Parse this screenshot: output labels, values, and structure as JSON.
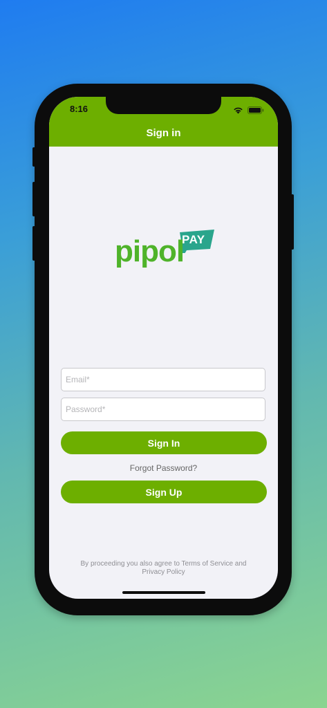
{
  "status_bar": {
    "time": "8:16",
    "wifi_icon": "wifi-icon",
    "battery_icon": "battery-icon"
  },
  "nav": {
    "title": "Sign in"
  },
  "logo": {
    "wordmark": "pipol",
    "badge": "PAY",
    "brand_green": "#4fb32a",
    "badge_color": "#2aa58c"
  },
  "form": {
    "email_placeholder": "Email*",
    "password_placeholder": "Password*",
    "email_value": "",
    "password_value": ""
  },
  "buttons": {
    "sign_in": "Sign In",
    "forgot_password": "Forgot Password?",
    "sign_up": "Sign Up"
  },
  "footer": {
    "legal_text": "By proceeding you also agree to Terms of Service and Privacy Policy"
  },
  "colors": {
    "accent": "#6daf00",
    "screen_bg": "#f2f2f7"
  }
}
